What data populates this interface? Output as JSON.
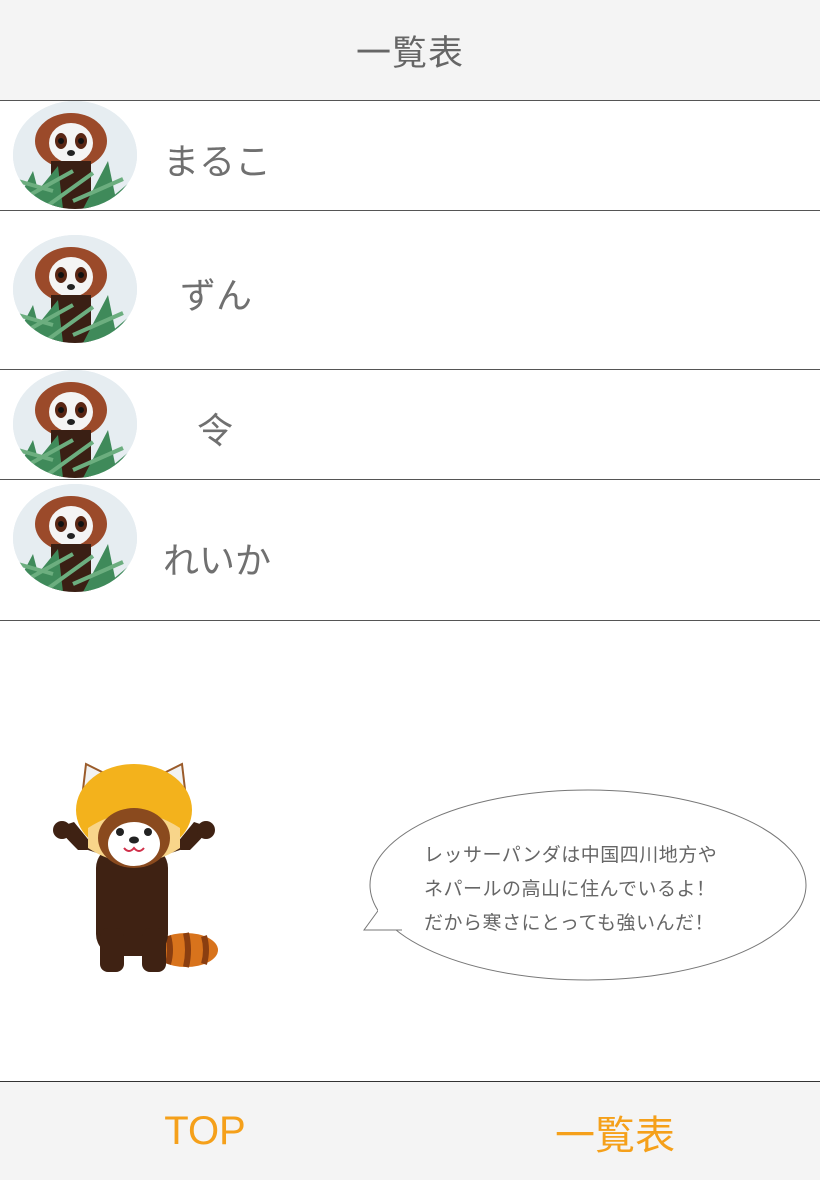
{
  "header": {
    "title": "一覧表"
  },
  "list": {
    "items": [
      {
        "label": "まるこ"
      },
      {
        "label": "ずん"
      },
      {
        "label": "令"
      },
      {
        "label": "れいか"
      }
    ]
  },
  "mascot": {
    "speech": [
      "レッサーパンダは中国四川地方や",
      "ネパールの高山に住んでいるよ！",
      "だから寒さにとっても強いんだ！"
    ]
  },
  "tab_bar": {
    "top_label": "TOP",
    "list_label": "一覧表",
    "accent_color": "#f5a01a"
  }
}
